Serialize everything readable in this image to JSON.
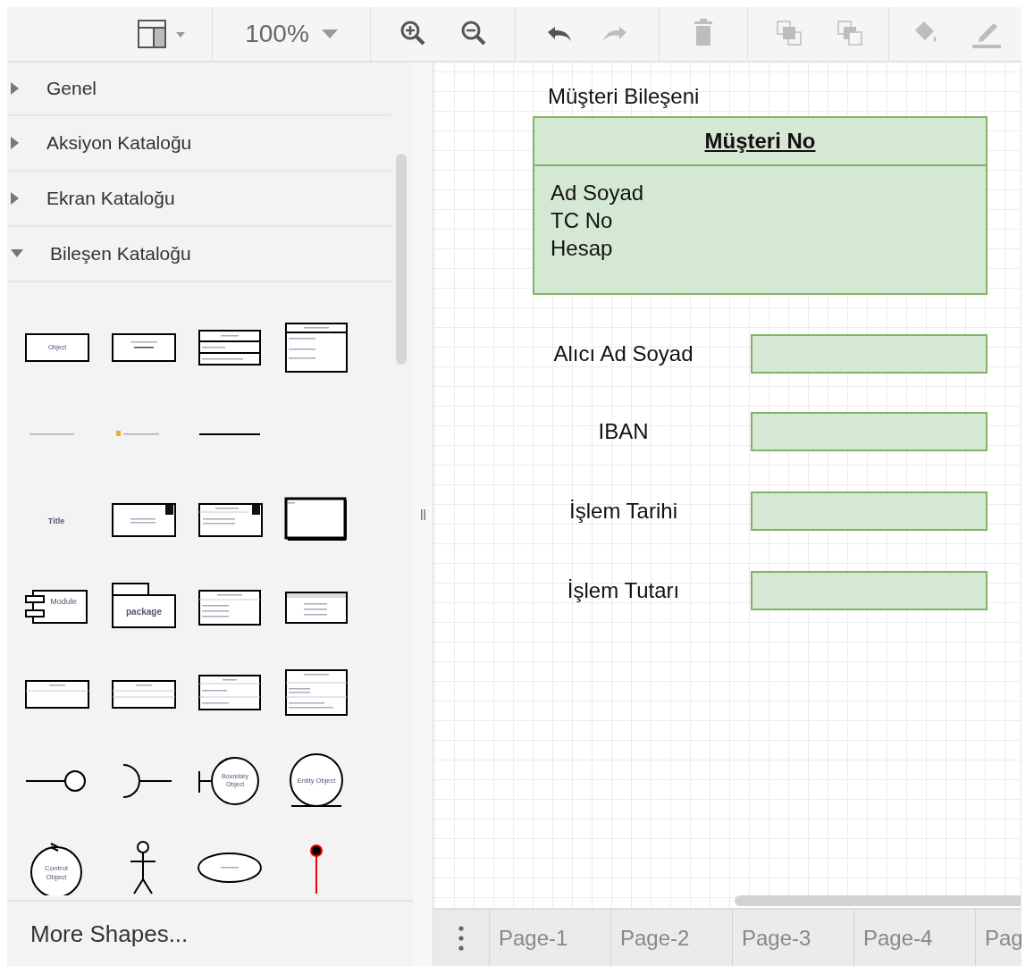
{
  "toolbar": {
    "groups": [
      [
        {
          "kind": "format_panel",
          "disabled": false
        }
      ],
      [
        {
          "kind": "zoom",
          "label": "100%"
        }
      ],
      [
        {
          "kind": "zoom_in",
          "disabled": false
        },
        {
          "kind": "zoom_out",
          "disabled": false
        }
      ],
      [
        {
          "kind": "undo",
          "disabled": false
        },
        {
          "kind": "redo",
          "disabled": true
        }
      ],
      [
        {
          "kind": "delete",
          "disabled": true
        }
      ],
      [
        {
          "kind": "to_front",
          "disabled": true
        },
        {
          "kind": "to_back",
          "disabled": true
        }
      ],
      [
        {
          "kind": "fill_color",
          "disabled": true
        },
        {
          "kind": "line_color",
          "disabled": true
        }
      ]
    ]
  },
  "sidebar": {
    "sections": [
      {
        "title": "Genel",
        "expanded": false
      },
      {
        "title": "Aksiyon Kataloğu",
        "expanded": false
      },
      {
        "title": "Ekran Kataloğu",
        "expanded": false
      },
      {
        "title": "Bileşen Kataloğu",
        "expanded": true
      }
    ],
    "shapes": [
      [
        {
          "kind": "object",
          "label": "Object"
        },
        {
          "kind": "instance"
        },
        {
          "kind": "class3"
        },
        {
          "kind": "classlist"
        }
      ],
      [
        {
          "kind": "item_attr"
        },
        {
          "kind": "item_method"
        },
        {
          "kind": "line"
        }
      ],
      [
        {
          "kind": "title",
          "label": "Title"
        },
        {
          "kind": "component_box"
        },
        {
          "kind": "component_attrs"
        },
        {
          "kind": "frame"
        }
      ],
      [
        {
          "kind": "module",
          "label": "Module"
        },
        {
          "kind": "package",
          "label": "package"
        },
        {
          "kind": "class_methods"
        },
        {
          "kind": "table"
        }
      ],
      [
        {
          "kind": "class_empty"
        },
        {
          "kind": "class_lines"
        },
        {
          "kind": "class_fields"
        },
        {
          "kind": "interface_box"
        }
      ],
      [
        {
          "kind": "lollipop"
        },
        {
          "kind": "socket"
        },
        {
          "kind": "boundary",
          "label": "Boundary Object"
        },
        {
          "kind": "entity",
          "label": "Entity Object"
        }
      ],
      [
        {
          "kind": "control",
          "label": "Control Object"
        },
        {
          "kind": "actor"
        },
        {
          "kind": "usecase"
        },
        {
          "kind": "lifeline"
        }
      ]
    ],
    "more_shapes": "More Shapes..."
  },
  "canvas": {
    "container_title": "Müşteri Bileşeni",
    "entity": {
      "header": "Müşteri No",
      "fields": [
        "Ad Soyad",
        "TC No",
        "Hesap"
      ]
    },
    "form_rows": [
      {
        "label": "Alıcı Ad Soyad"
      },
      {
        "label": "IBAN"
      },
      {
        "label": "İşlem Tarihi"
      },
      {
        "label": "İşlem Tutarı"
      }
    ]
  },
  "pages": [
    {
      "label": "Page-1",
      "selected": false
    },
    {
      "label": "Page-2",
      "selected": false
    },
    {
      "label": "Page-3",
      "selected": false
    },
    {
      "label": "Page-4",
      "selected": false
    },
    {
      "label": "Pag",
      "selected": false
    }
  ]
}
